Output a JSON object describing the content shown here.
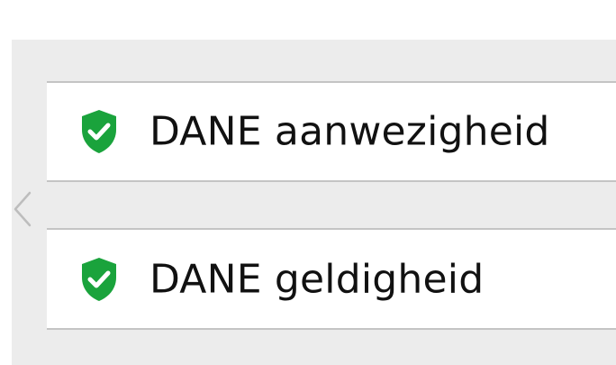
{
  "colors": {
    "panel_bg": "#ececec",
    "card_bg": "#ffffff",
    "divider": "#c4c4c4",
    "shield_green": "#1aa33c",
    "text": "#111111"
  },
  "navigation": {
    "prev_icon": "chevron-left-icon"
  },
  "checks": [
    {
      "label": "DANE aanwezigheid",
      "status": "pass",
      "icon": "shield-check-icon"
    },
    {
      "label": "DANE geldigheid",
      "status": "pass",
      "icon": "shield-check-icon"
    }
  ]
}
